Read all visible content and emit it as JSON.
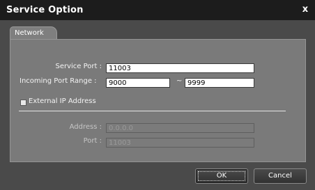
{
  "window": {
    "title": "Service Option",
    "close_glyph": "x"
  },
  "tabs": [
    {
      "label": "Network"
    }
  ],
  "form": {
    "service_port": {
      "label": "Service Port :",
      "value": "11003"
    },
    "incoming_port_range": {
      "label": "Incoming Port Range :",
      "from": "9000",
      "separator": "~",
      "to": "9999"
    },
    "external_ip": {
      "label": "External IP Address",
      "checked": false
    },
    "address": {
      "label": "Address :",
      "value": "0.0.0.0"
    },
    "port": {
      "label": "Port :",
      "value": "11003"
    }
  },
  "buttons": {
    "ok": "OK",
    "cancel": "Cancel"
  },
  "colors": {
    "titlebar": "#1c1c1c",
    "window_bg": "#4a4a4a",
    "panel_bg": "#7a7a7a"
  }
}
